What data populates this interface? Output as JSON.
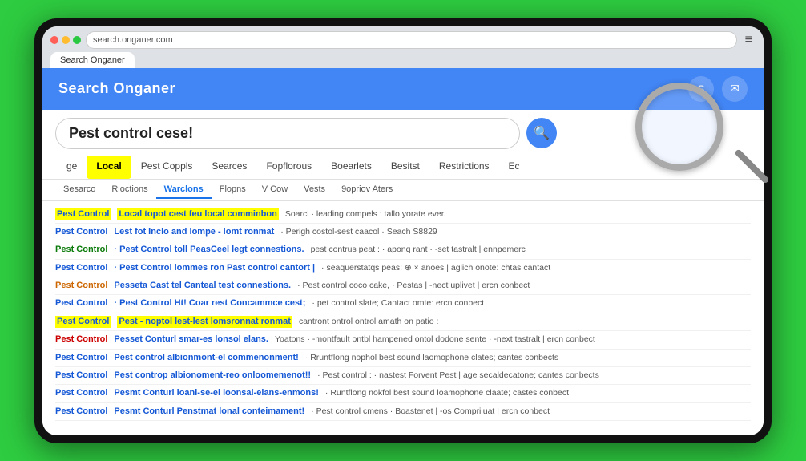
{
  "device": {
    "frame_label": "Browser device frame"
  },
  "browser": {
    "address_bar_text": "search.onganer.com",
    "tab_label": "Search Onganer",
    "menu_symbol": "≡"
  },
  "search_header": {
    "title": "Search Onganer",
    "icon1": "S",
    "icon2": "✉"
  },
  "search_bar": {
    "query": "Pest control cese!",
    "search_button_label": "🔍"
  },
  "main_nav": {
    "items": [
      {
        "label": "ge",
        "active": false,
        "highlight": false
      },
      {
        "label": "Local",
        "active": false,
        "highlight": true
      },
      {
        "label": "Pest Coppls",
        "active": false,
        "highlight": false
      },
      {
        "label": "Searces",
        "active": false,
        "highlight": false
      },
      {
        "label": "Fopflorous",
        "active": false,
        "highlight": false
      },
      {
        "label": "Boearlets",
        "active": false,
        "highlight": false
      },
      {
        "label": "Besitst",
        "active": false,
        "highlight": false
      },
      {
        "label": "Restrictions",
        "active": false,
        "highlight": false
      },
      {
        "label": "Ec",
        "active": false,
        "highlight": false
      }
    ]
  },
  "sub_nav": {
    "items": [
      {
        "label": "Sesarco",
        "active": false
      },
      {
        "label": "Rioctions",
        "active": false
      },
      {
        "label": "Warclons",
        "active": true
      },
      {
        "label": "Flopns",
        "active": false
      },
      {
        "label": "V Cow",
        "active": false
      },
      {
        "label": "Vests",
        "active": false
      },
      {
        "label": "9opriov Aters",
        "active": false
      }
    ]
  },
  "results": [
    {
      "title": "Pest Control",
      "title_class": "yellow-hl",
      "subtitle": "Local  topot cest feu local comminbon",
      "subtitle_class": "yellow-hl",
      "snippet": "Soarcl · leading compels : tallo yorate ever."
    },
    {
      "title": "Pest Control",
      "title_class": "",
      "subtitle": "Lest  fot Inclo and lompe - lomt ronmat",
      "subtitle_class": "",
      "snippet": "· Perigh costol-sest caacol · Seach S8829"
    },
    {
      "title": "Pest Control",
      "title_class": "green",
      "subtitle": "· Pest Control toll PeasCeel legt connestions.",
      "subtitle_class": "",
      "snippet": "pest contrus peat : · aponq rant · -set tastralt | ennpemerc"
    },
    {
      "title": "Pest Control",
      "title_class": "",
      "subtitle": "· Pest Control lommes ron Past control cantort |",
      "subtitle_class": "",
      "snippet": "· seaquerstatqs peas: ⊕ × anoes | aglich onote: chtas cantact"
    },
    {
      "title": "Pest Control",
      "title_class": "orange",
      "subtitle": "Pesseta Cast tel Canteal test connestions.",
      "subtitle_class": "",
      "snippet": "· Pest control coco cake, · Pestas | -nect uplivet | ercn conbect"
    },
    {
      "title": "Pest Control",
      "title_class": "",
      "subtitle": "· Pest Control Ht! Coar rest Concammce cest;",
      "subtitle_class": "",
      "snippet": "· pet control slate; Cantact omte: ercn conbect"
    },
    {
      "title": "Pest Control",
      "title_class": "yellow-hl",
      "subtitle": "Pest - noptol  lest-lest lomsronnat ronmat",
      "subtitle_class": "yellow-hl",
      "snippet": "cantront ontrol ontrol amath on patio :"
    },
    {
      "title": "Pest Control",
      "title_class": "red",
      "subtitle": "Pesset Conturl smar-es lonsol elans.",
      "subtitle_class": "",
      "snippet": "Yoatons · -montfault ontbl hampened ontol dodone sente · -next tastralt | ercn conbect"
    },
    {
      "title": "Pest Control",
      "title_class": "",
      "subtitle": "Pest control albionmont-el commenonment!",
      "subtitle_class": "",
      "snippet": "· Rruntflong nophol best sound laomophone clates; cantes conbects"
    },
    {
      "title": "Pest Control",
      "title_class": "",
      "subtitle": "Pest controp albionoment-reo onloomemenot!!",
      "subtitle_class": "",
      "snippet": "· Pest control : · nastest Forvent Pest | age secaldecatone; cantes conbects"
    },
    {
      "title": "Pest Control",
      "title_class": "",
      "subtitle": "Pesmt Conturl loanl-se-el loonsal-elans-enmons!",
      "subtitle_class": "",
      "snippet": "· Runtflong nokfol best sound loamophone claate; castes conbect"
    },
    {
      "title": "Pest Control",
      "title_class": "",
      "subtitle": "Pesmt Conturl Penstmat lonal conteimament!",
      "subtitle_class": "",
      "snippet": "· Pest control cmens · Boastenet | -os Compriluat | ercn conbect"
    }
  ]
}
